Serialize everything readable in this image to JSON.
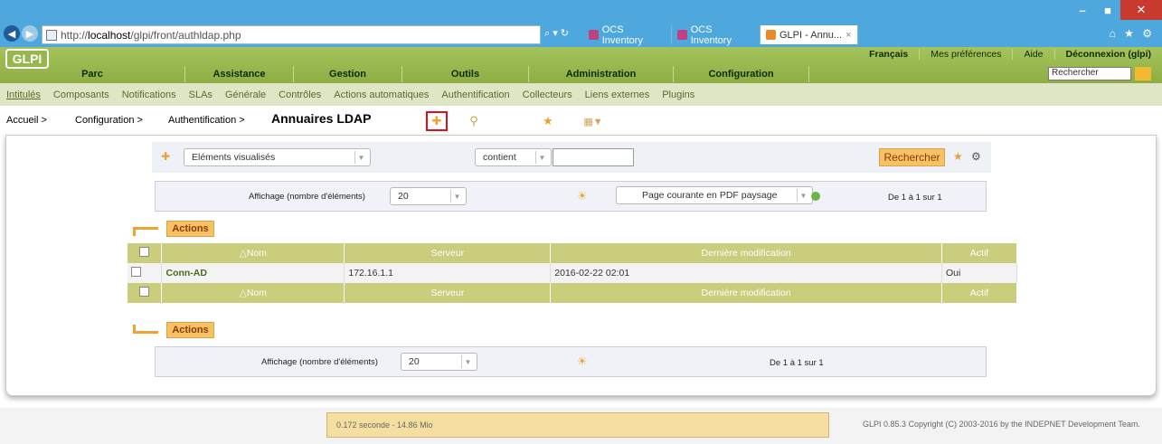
{
  "browser": {
    "url_prefix": "http://",
    "url_host": "localhost",
    "url_path": "/glpi/front/authldap.php",
    "addr_tools": "⌕ ▾ ↻",
    "tabs": [
      {
        "label": "OCS Inventory",
        "active": false
      },
      {
        "label": "OCS Inventory",
        "active": false
      },
      {
        "label": "GLPI - Annu...",
        "active": true
      }
    ],
    "right_icons": "⌂ ★ ⚙"
  },
  "header": {
    "logo": "GLPI",
    "prefs": [
      "Français",
      "Mes préférences",
      "Aide",
      "Déconnexion (glpi)"
    ],
    "search_value": "Rechercher",
    "menu": [
      "Parc",
      "Assistance",
      "Gestion",
      "Outils",
      "Administration",
      "Configuration"
    ]
  },
  "submenu": [
    "Intitulés",
    "Composants",
    "Notifications",
    "SLAs",
    "Générale",
    "Contrôles",
    "Actions automatiques",
    "Authentification",
    "Collecteurs",
    "Liens externes",
    "Plugins"
  ],
  "breadcrumb": {
    "items": [
      "Accueil >",
      "Configuration >",
      "Authentification >"
    ],
    "title": "Annuaires LDAP"
  },
  "search": {
    "field": "Eléments visualisés",
    "operator": "contient",
    "value": "",
    "button": "Rechercher"
  },
  "pager": {
    "label": "Affichage (nombre d'éléments)",
    "per_page": "20",
    "export": "Page courante en PDF paysage",
    "count": "De 1 à 1 sur 1"
  },
  "pager_bottom": {
    "label": "Affichage (nombre d'éléments)",
    "per_page": "20",
    "count": "De 1 à 1 sur 1"
  },
  "actions_label": "Actions",
  "table": {
    "headers": [
      "△Nom",
      "Serveur",
      "Dernière modification",
      "Actif"
    ],
    "rows": [
      {
        "name": "Conn-AD",
        "server": "172.16.1.1",
        "modified": "2016-02-22 02:01",
        "active": "Oui"
      }
    ]
  },
  "footer": {
    "left": "0.172 seconde - 14.86 Mio",
    "right": "GLPI 0.85.3 Copyright (C) 2003-2016 by the INDEPNET Development Team."
  },
  "colors": {
    "browser_bar": "#4ea7dd",
    "glpi_green": "#97b74a",
    "button_orange": "#f7c266",
    "table_header": "#c9cd7c"
  }
}
